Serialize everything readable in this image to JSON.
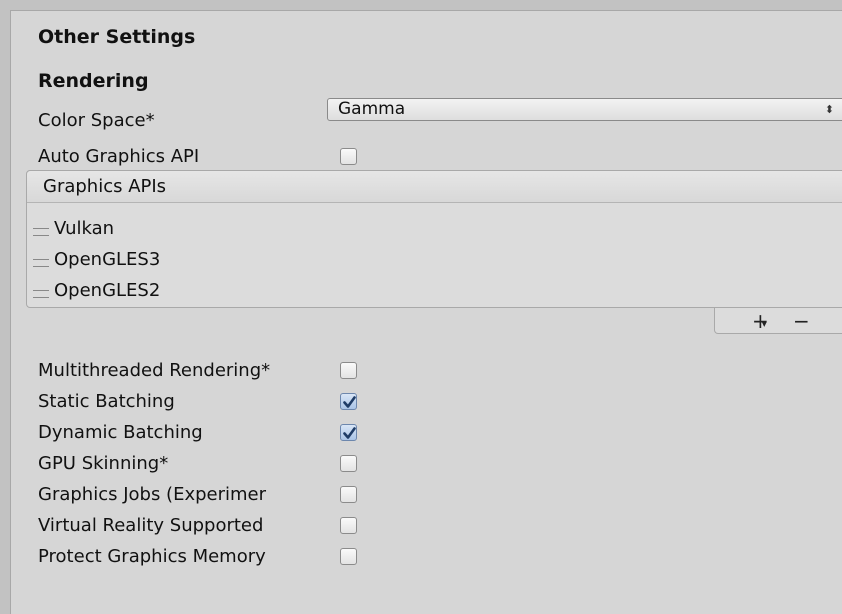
{
  "section": {
    "title": "Other Settings"
  },
  "rendering": {
    "title": "Rendering"
  },
  "color_space": {
    "label": "Color Space*",
    "value": "Gamma",
    "arrow_icon": "⬍"
  },
  "auto_graphics_api": {
    "label": "Auto Graphics API",
    "checked": false
  },
  "graphics_apis": {
    "header": "Graphics APIs",
    "items": [
      {
        "label": "Vulkan"
      },
      {
        "label": "OpenGLES3"
      },
      {
        "label": "OpenGLES2"
      }
    ],
    "add_label": "+",
    "remove_label": "−"
  },
  "toggles": [
    {
      "label": "Multithreaded Rendering*",
      "checked": false
    },
    {
      "label": "Static Batching",
      "checked": true
    },
    {
      "label": "Dynamic Batching",
      "checked": true
    },
    {
      "label": "GPU Skinning*",
      "checked": false
    },
    {
      "label": "Graphics Jobs (Experimer",
      "checked": false
    },
    {
      "label": "Virtual Reality Supported",
      "checked": false
    },
    {
      "label": "Protect Graphics Memory",
      "checked": false
    }
  ],
  "colors": {
    "panel": "#d6d6d6",
    "check_fill": "#aac4e6",
    "check_mark": "#1f3c66"
  }
}
